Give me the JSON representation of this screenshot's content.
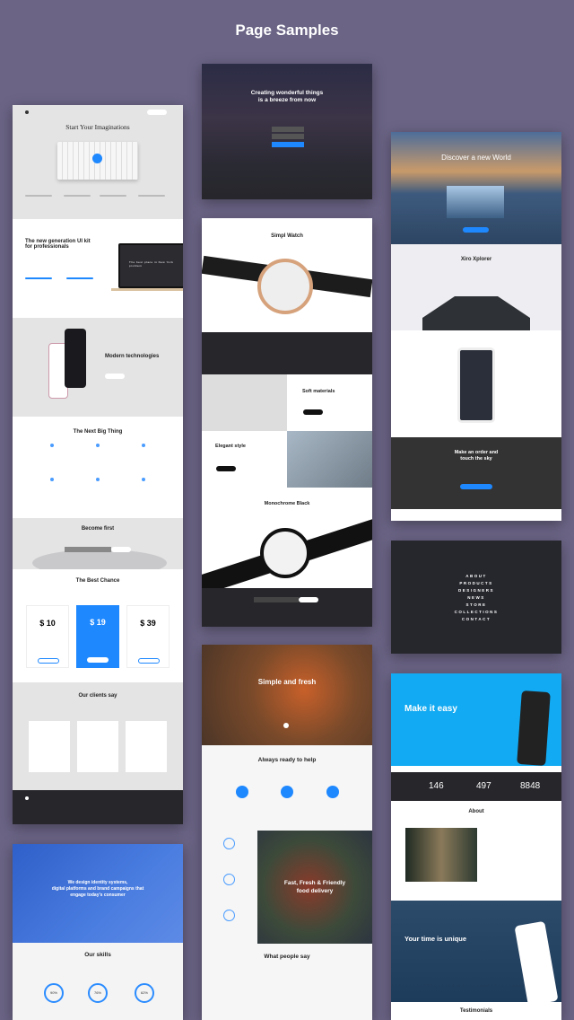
{
  "page_title": "Page Samples",
  "colors": {
    "background": "#6b6485",
    "accent": "#1e88ff",
    "dark": "#26262b"
  },
  "samples": {
    "imaginations": {
      "hero_title": "Start Your Imaginations",
      "generation_title": "The new generation UI kit for professionals",
      "laptop_caption": "The best place in New York problem",
      "modern_title": "Modern technologies",
      "next_title": "The Next Big Thing",
      "become_title": "Become first",
      "best_title": "The Best Chance",
      "prices": [
        "$ 10",
        "$ 19",
        "$ 39"
      ],
      "clients_title": "Our clients say"
    },
    "identity": {
      "hero_text_1": "We design identity systems,",
      "hero_text_2": "digital platforms and brand campaigns that",
      "hero_text_3": "engage today's consumer",
      "skills_title": "Our skills",
      "skills": [
        "90%",
        "76%",
        "62%"
      ]
    },
    "creating": {
      "hero_line_1": "Creating wonderful things",
      "hero_line_2": "is a breeze from now"
    },
    "watch": {
      "title": "Simpl Watch",
      "soft": "Soft materials",
      "elegant": "Elegant style",
      "mono": "Monochrome Black"
    },
    "fresh": {
      "hero_title": "Simple and fresh",
      "help_title": "Always ready to help",
      "delivery_1": "Fast, Fresh & Friendly",
      "delivery_2": "food delivery",
      "people_title": "What people say"
    },
    "world": {
      "hero_title": "Discover a new World",
      "xiro_title": "Xiro Xplorer",
      "order_1": "Make an order and",
      "order_2": "touch the sky"
    },
    "menu": {
      "items": [
        "ABOUT",
        "PRODUCTS",
        "DESIGNERS",
        "NEWS",
        "STORE",
        "COLLECTIONS",
        "CONTACT"
      ]
    },
    "easy": {
      "hero_title": "Make it easy",
      "stats": [
        "146",
        "497",
        "8848"
      ],
      "about_title": "About",
      "unique_title": "Your time is unique",
      "testimonials_title": "Testimonials"
    }
  }
}
